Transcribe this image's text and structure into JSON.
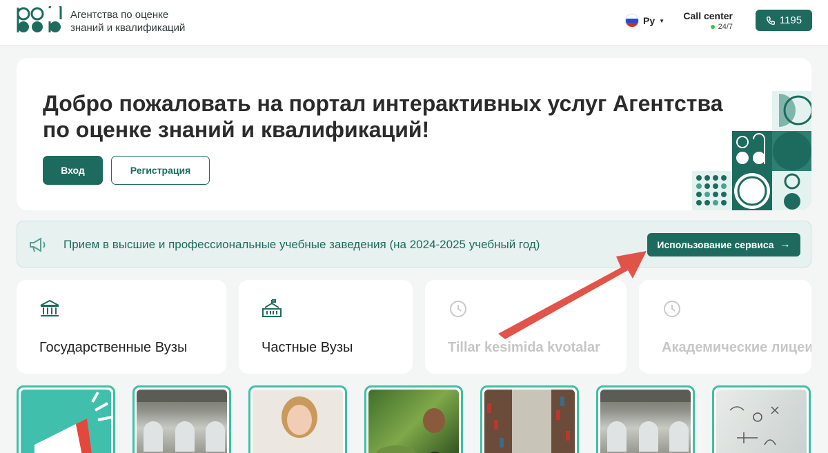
{
  "header": {
    "logo_text_line1": "Агентства по оценке",
    "logo_text_line2": "знаний и квалификаций",
    "language": "Ру",
    "call_center_label": "Call center",
    "call_center_hours": "24/7",
    "phone_number": "1195"
  },
  "hero": {
    "title": "Добро пожаловать на портал интерактивных услуг Агентства по оценке знаний и квалификаций!",
    "login_label": "Вход",
    "register_label": "Регистрация"
  },
  "banner": {
    "text": "Прием в высшие и профессиональные учебные заведения (на 2024-2025 учебный год)",
    "button_label": "Использование сервиса"
  },
  "categories": [
    {
      "label": "Государственные Вузы",
      "icon": "government-building-icon",
      "enabled": true
    },
    {
      "label": "Частные Вузы",
      "icon": "school-building-icon",
      "enabled": true
    },
    {
      "label": "Tillar kesimida kvotalar",
      "icon": "clock-icon",
      "enabled": false
    },
    {
      "label": "Академические лицеи",
      "icon": "clock-icon",
      "enabled": false
    }
  ],
  "colors": {
    "primary": "#1d6b5e",
    "accent_border": "#3bc0a4",
    "banner_bg": "#e6f1f0",
    "annotation_arrow": "#e0453a"
  }
}
